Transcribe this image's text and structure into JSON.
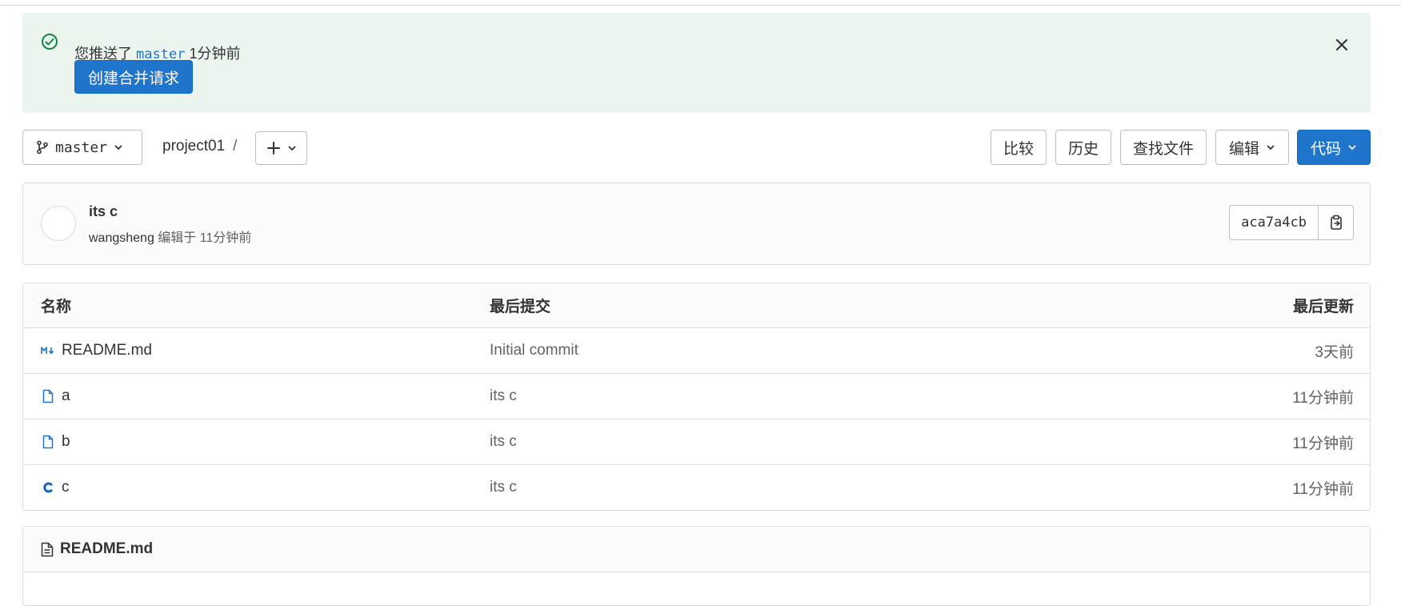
{
  "alert": {
    "text_prefix": "您推送了",
    "branch": "master",
    "text_suffix": "1分钟前",
    "button": "创建合并请求"
  },
  "toolbar": {
    "branch": "master",
    "breadcrumb": "project01",
    "separator": "/",
    "buttons": {
      "compare": "比较",
      "history": "历史",
      "find_file": "查找文件",
      "edit": "编辑",
      "code": "代码"
    }
  },
  "commit": {
    "title": "its c",
    "author": "wangsheng",
    "meta": "编辑于 11分钟前",
    "sha": "aca7a4cb"
  },
  "file_table": {
    "headers": {
      "name": "名称",
      "last_commit": "最后提交",
      "last_update": "最后更新"
    },
    "rows": [
      {
        "name": "README.md",
        "commit": "Initial commit",
        "updated": "3天前",
        "icon": "markdown-icon"
      },
      {
        "name": "a",
        "commit": "its c",
        "updated": "11分钟前",
        "icon": "file-icon"
      },
      {
        "name": "b",
        "commit": "its c",
        "updated": "11分钟前",
        "icon": "file-icon"
      },
      {
        "name": "c",
        "commit": "its c",
        "updated": "11分钟前",
        "icon": "c-language-icon"
      }
    ]
  },
  "readme": {
    "title": "README.md"
  },
  "colors": {
    "primary": "#1f75cb",
    "alert_bg": "#ecf4ee",
    "success": "#108548"
  }
}
